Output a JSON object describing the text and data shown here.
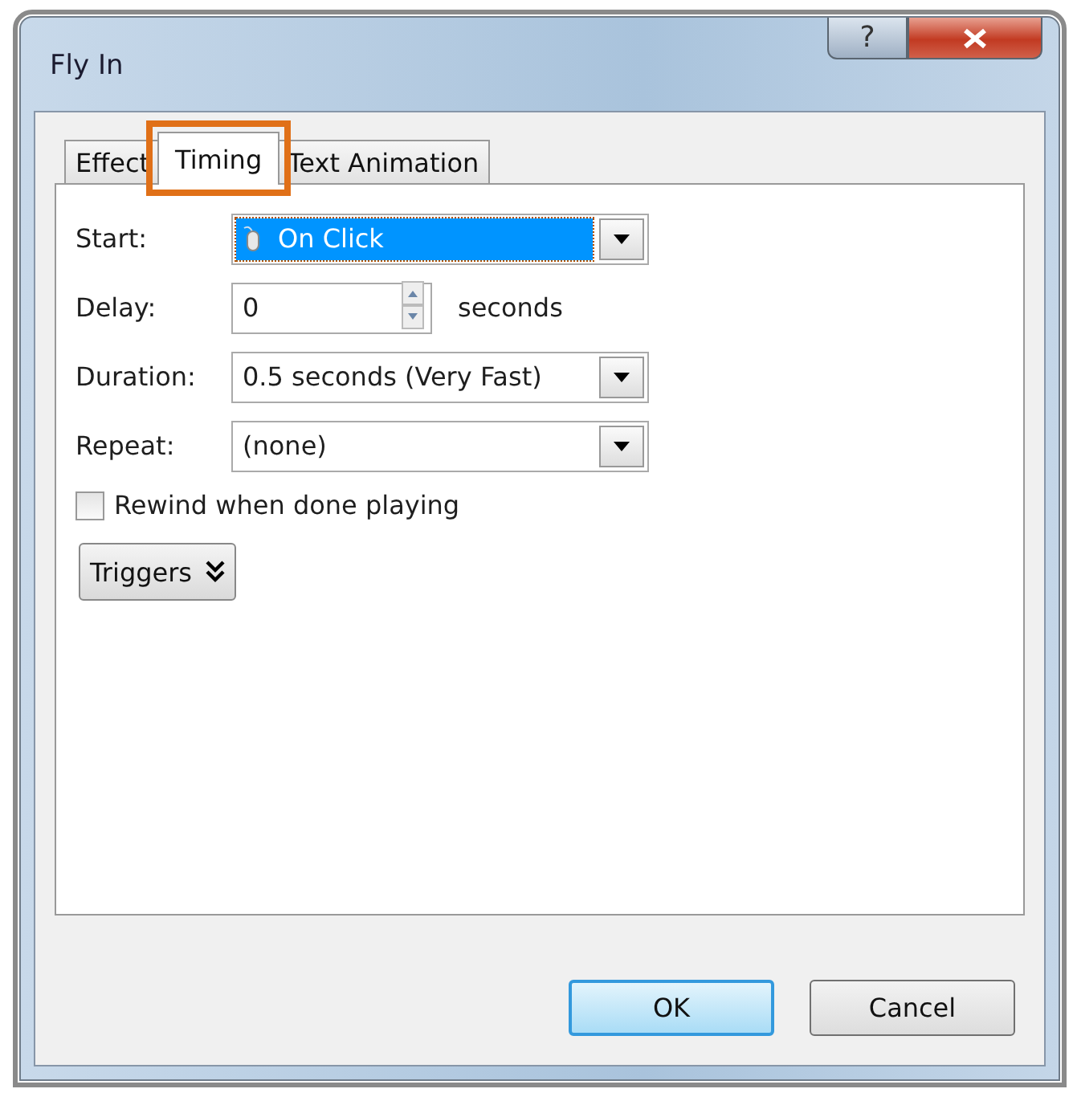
{
  "window": {
    "title": "Fly In",
    "help": "?"
  },
  "tabs": [
    {
      "label": "Effect",
      "selected": false
    },
    {
      "label": "Timing",
      "selected": true
    },
    {
      "label": "Text Animation",
      "selected": false
    }
  ],
  "rows": [
    {
      "kind": "dropdown",
      "label": "Start:",
      "value": "On Click",
      "highlighted": true
    },
    {
      "kind": "spinner",
      "label": "Delay:",
      "value": "0",
      "unit": "seconds"
    },
    {
      "kind": "dropdown",
      "label": "Duration:",
      "value": "0.5 seconds (Very Fast)",
      "highlighted": false
    },
    {
      "kind": "dropdown",
      "label": "Repeat:",
      "value": "(none)",
      "highlighted": false
    }
  ],
  "rewind": {
    "label": "Rewind when done playing",
    "checked": false
  },
  "triggers": "Triggers",
  "buttons": [
    {
      "label": "OK",
      "default": true
    },
    {
      "label": "Cancel",
      "default": false
    }
  ]
}
